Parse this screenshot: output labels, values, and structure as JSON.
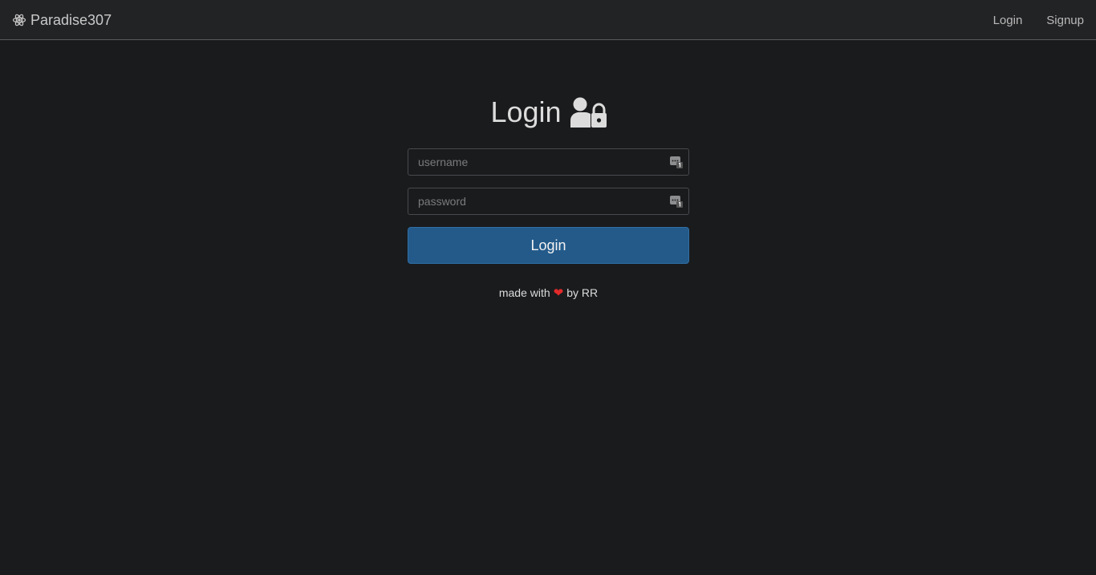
{
  "navbar": {
    "brand_icon": "atom-icon",
    "brand_label": "Paradise307",
    "links": [
      {
        "label": "Login"
      },
      {
        "label": "Signup"
      }
    ]
  },
  "form": {
    "title": "Login",
    "title_icon": "user-lock-icon",
    "username_placeholder": "username",
    "username_value": "",
    "password_placeholder": "password",
    "password_value": "",
    "field_badge_icon": "password-manager-icon",
    "submit_label": "Login"
  },
  "footer": {
    "prefix": "made with",
    "heart": "❤",
    "suffix": "by RR"
  },
  "colors": {
    "background": "#1a1b1d",
    "navbar": "#222325",
    "primary_button": "#235a8a",
    "heart": "#e22a2a"
  }
}
